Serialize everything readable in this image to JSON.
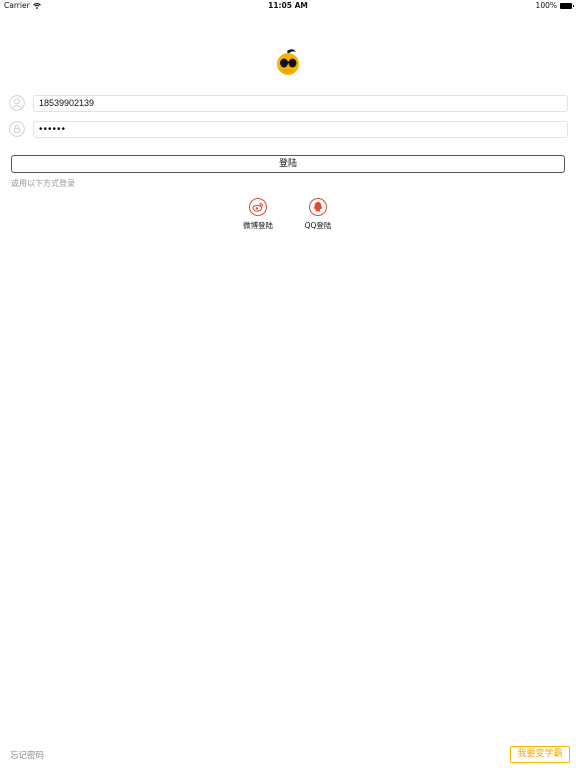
{
  "status_bar": {
    "carrier": "Carrier",
    "wifi_icon": "wifi-icon",
    "time": "11:05 AM",
    "battery": "100%",
    "battery_icon": "battery-icon"
  },
  "logo": {
    "icon": "eye-mascot-logo",
    "color": "#f5b400"
  },
  "login_form": {
    "username": {
      "icon": "user-icon",
      "value": "18539902139"
    },
    "password": {
      "icon": "lock-icon",
      "value": "••••••"
    },
    "login_button_label": "登陆",
    "alt_login_hint": "或用以下方式登录"
  },
  "social_logins": [
    {
      "label": "微博登陆",
      "icon": "weibo-icon"
    },
    {
      "label": "QQ登陆",
      "icon": "qq-icon"
    }
  ],
  "footer": {
    "forgot_password": "忘记密码",
    "register_button": "我要变学霸",
    "accent_color": "#f5b400"
  }
}
